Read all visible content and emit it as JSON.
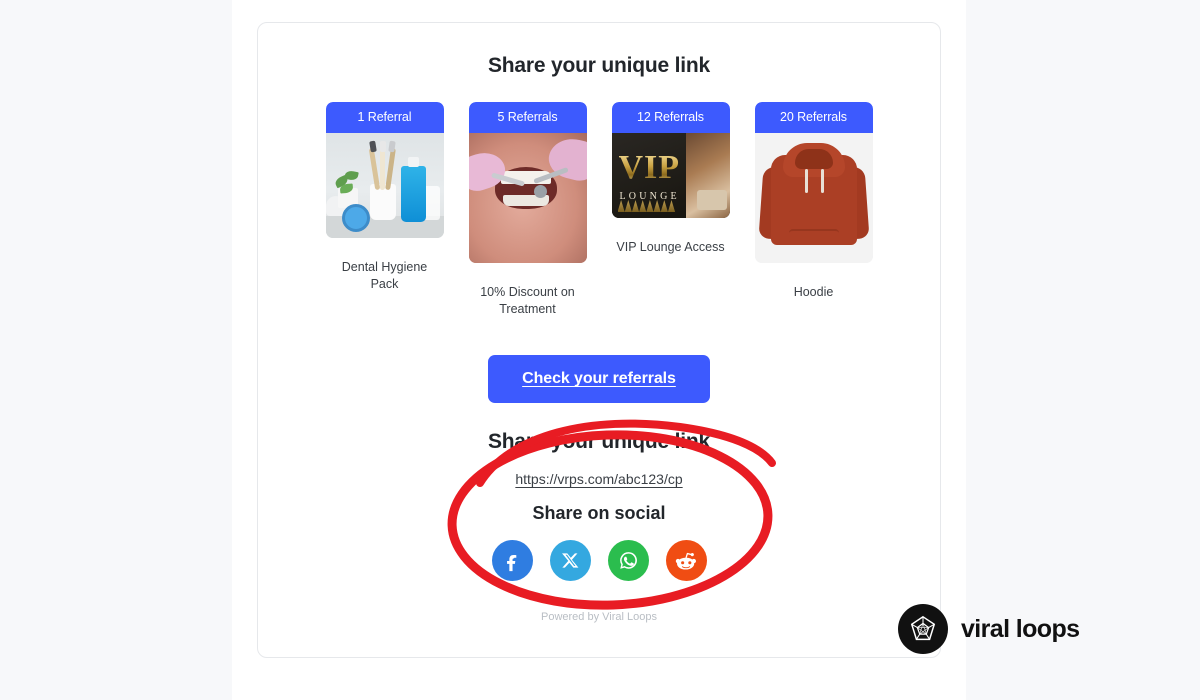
{
  "widget": {
    "title": "Share your unique link",
    "rewards": [
      {
        "badge": "1 Referral",
        "label": "Dental Hygiene Pack",
        "art": "dental"
      },
      {
        "badge": "5 Referrals",
        "label": "10% Discount on Treatment",
        "art": "treat"
      },
      {
        "badge": "12 Referrals",
        "label": "VIP Lounge Access",
        "art": "vip"
      },
      {
        "badge": "20 Referrals",
        "label": "Hoodie",
        "art": "hoodie"
      }
    ],
    "cta_label": "Check your referrals",
    "share_title": "Share your unique link",
    "share_url": "https://vrps.com/abc123/cp",
    "social_title": "Share on social",
    "social": [
      {
        "name": "facebook",
        "color": "#2f7de1"
      },
      {
        "name": "x",
        "color": "#34a8e0"
      },
      {
        "name": "whatsapp",
        "color": "#2bbd4e"
      },
      {
        "name": "reddit",
        "color": "#f04d13"
      }
    ],
    "powered_by": "Powered by Viral Loops"
  },
  "vip_art": {
    "vip_text": "VIP",
    "lounge_text": "LOUNGE"
  },
  "brand": {
    "logo_text": "viral loops",
    "accent_blue": "#3d5afe",
    "annotation_red": "#e81c23"
  }
}
